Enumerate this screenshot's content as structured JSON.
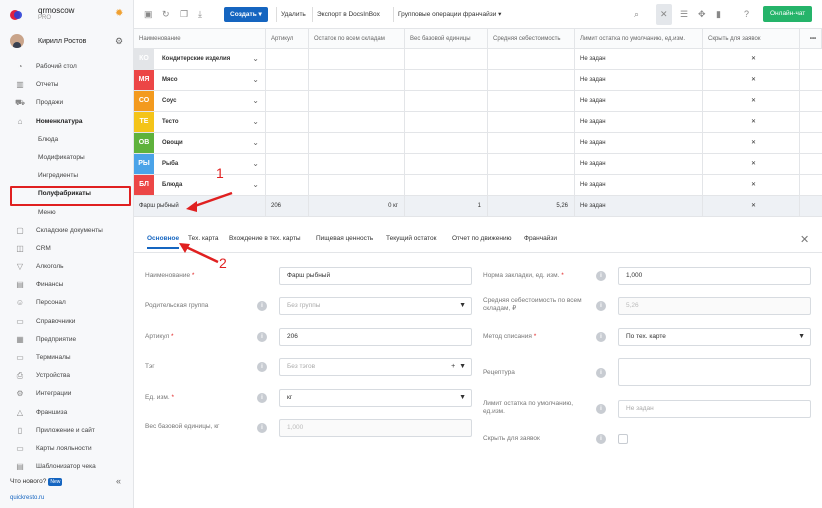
{
  "brand": {
    "name": "qrmoscow",
    "plan": "PRO"
  },
  "user": {
    "name": "Кирилл Ростов"
  },
  "nav": [
    {
      "label": "Рабочий стол",
      "icon": "dashboard-icon",
      "glyph": "◔"
    },
    {
      "label": "Отчеты",
      "icon": "reports-icon",
      "glyph": "▥"
    },
    {
      "label": "Продажи",
      "icon": "cart-icon",
      "glyph": "⛟"
    },
    {
      "label": "Номенклатура",
      "icon": "tag-icon",
      "glyph": "⌂",
      "bold": true
    },
    {
      "label": "Блюда",
      "sub": true
    },
    {
      "label": "Модификаторы",
      "sub": true
    },
    {
      "label": "Ингредиенты",
      "sub": true
    },
    {
      "label": "Полуфабрикаты",
      "sub": true,
      "highlight": true
    },
    {
      "label": "Меню",
      "sub": true
    },
    {
      "label": "Складские документы",
      "icon": "box-icon",
      "glyph": "▢"
    },
    {
      "label": "CRM",
      "icon": "crm-icon",
      "glyph": "◫"
    },
    {
      "label": "Алкоголь",
      "icon": "glass-icon",
      "glyph": "▽"
    },
    {
      "label": "Финансы",
      "icon": "finance-icon",
      "glyph": "▤"
    },
    {
      "label": "Персонал",
      "icon": "staff-icon",
      "glyph": "☺"
    },
    {
      "label": "Справочники",
      "icon": "book-icon",
      "glyph": "▭"
    },
    {
      "label": "Предприятие",
      "icon": "building-icon",
      "glyph": "▦"
    },
    {
      "label": "Терминалы",
      "icon": "terminal-icon",
      "glyph": "▭"
    },
    {
      "label": "Устройства",
      "icon": "printer-icon",
      "glyph": "⎙"
    },
    {
      "label": "Интеграции",
      "icon": "plug-icon",
      "glyph": "⚙"
    },
    {
      "label": "Франшиза",
      "icon": "franchise-icon",
      "glyph": "△"
    },
    {
      "label": "Приложение и сайт",
      "icon": "app-icon",
      "glyph": "▯"
    },
    {
      "label": "Карты лояльности",
      "icon": "card-icon",
      "glyph": "▭"
    },
    {
      "label": "Шаблонизатор чека",
      "icon": "receipt-icon",
      "glyph": "▤"
    }
  ],
  "whatsnew": {
    "label": "Что нового?",
    "badge": "New"
  },
  "site": "quickresto.ru",
  "toolbar": {
    "create": "Создать",
    "delete": "Удалить",
    "export": "Экспорт в DocsInBox",
    "franchise_ops": "Групповые операции франчайзи",
    "chat": "Онлайн-чат"
  },
  "grid": {
    "headers": [
      "Наименование",
      "Артикул",
      "Остаток по всем складам",
      "Вес базовой единицы",
      "Средняя себестоимость",
      "Лимит остатка по умолчанию, ед.изм.",
      "Скрыть для заявок"
    ],
    "groups": [
      {
        "abbr": "КО",
        "name": "Кондитерские изделия",
        "color": "#e3e5e8",
        "limit": "Не задан"
      },
      {
        "abbr": "МЯ",
        "name": "Мясо",
        "color": "#ec4646",
        "limit": "Не задан"
      },
      {
        "abbr": "СО",
        "name": "Соус",
        "color": "#f39a1e",
        "limit": "Не задан"
      },
      {
        "abbr": "ТЕ",
        "name": "Тесто",
        "color": "#f4c419",
        "limit": "Не задан"
      },
      {
        "abbr": "ОВ",
        "name": "Овощи",
        "color": "#5fb23c",
        "limit": "Не задан"
      },
      {
        "abbr": "РЫ",
        "name": "Рыба",
        "color": "#4aa3e8",
        "limit": "Не задан"
      },
      {
        "abbr": "БЛ",
        "name": "Блюда",
        "color": "#ec4646",
        "limit": "Не задан"
      }
    ],
    "selected": {
      "name": "Фарш рыбный",
      "article": "206",
      "stock": "0 кг",
      "weight": "1",
      "cost": "5,26",
      "limit": "Не задан"
    }
  },
  "tabs": [
    "Основное",
    "Тех. карта",
    "Вхождение в тех. карты",
    "Пищевая ценность",
    "Текущий остаток",
    "Отчет по движению",
    "Франчайзи"
  ],
  "form": {
    "name_label": "Наименование",
    "name_value": "Фарш рыбный",
    "parent_label": "Родительская группа",
    "parent_value": "Без группы",
    "article_label": "Артикул",
    "article_value": "206",
    "tag_label": "Тэг",
    "tag_value": "Без тэгов",
    "unit_label": "Ед. изм.",
    "unit_value": "кг",
    "weight_label": "Вес базовой единицы, кг",
    "weight_value": "1,000",
    "norm_label": "Норма закладки, ед. изм.",
    "norm_value": "1,000",
    "avgcost_label": "Средняя себестоимость по всем складам, ₽",
    "avgcost_value": "5,26",
    "writeoff_label": "Метод списания",
    "writeoff_value": "По тех. карте",
    "recipe_label": "Рецептура",
    "limit_label": "Лимит остатка по умолчанию, ед.изм.",
    "limit_value": "Не задан",
    "hide_label": "Скрыть для заявок"
  },
  "annotations": [
    "1",
    "2"
  ],
  "icon_glyphs": {
    "info": "i",
    "close": "✕",
    "caret": "▾",
    "plus": "+",
    "chevron": "⌄"
  }
}
